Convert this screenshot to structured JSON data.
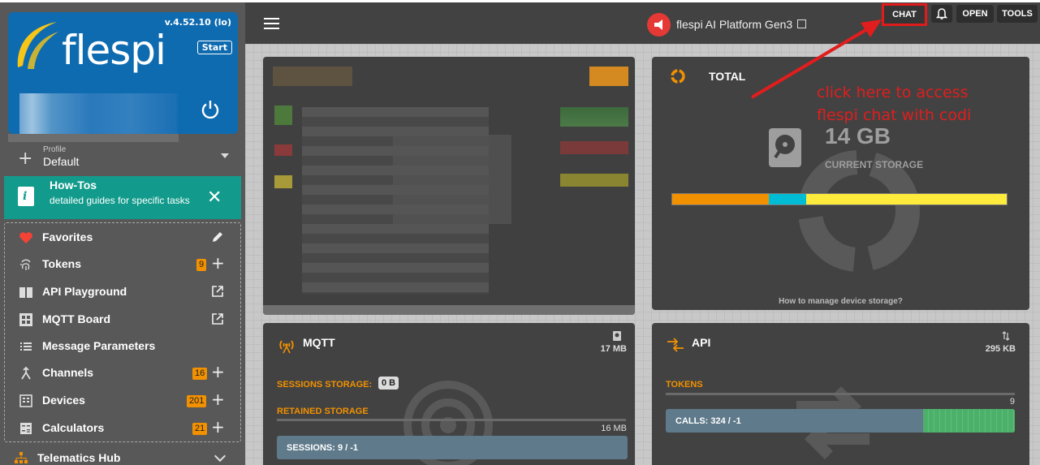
{
  "sidebar": {
    "brand": {
      "logo_text": "flespi",
      "version": "v.4.52.10 (lo)",
      "start_label": "Start"
    },
    "profile": {
      "label": "Profile",
      "value": "Default"
    },
    "howto": {
      "title": "How-Tos",
      "description": "detailed guides for specific tasks"
    },
    "items": [
      {
        "label": "Favorites",
        "icon": "heart-icon"
      },
      {
        "label": "Tokens",
        "icon": "fingerprint-icon",
        "badge": "9"
      },
      {
        "label": "API Playground",
        "icon": "book-icon"
      },
      {
        "label": "MQTT Board",
        "icon": "grid-icon"
      },
      {
        "label": "Message Parameters",
        "icon": "list-icon"
      },
      {
        "label": "Channels",
        "icon": "merge-icon",
        "badge": "16"
      },
      {
        "label": "Devices",
        "icon": "device-icon",
        "badge": "201"
      },
      {
        "label": "Calculators",
        "icon": "calculator-icon",
        "badge": "21"
      }
    ],
    "section": {
      "label": "Telematics Hub"
    }
  },
  "topbar": {
    "platform_title": "flespi AI Platform Gen3",
    "chat_label": "CHAT",
    "open_label": "OPEN",
    "tools_label": "TOOLS"
  },
  "total_card": {
    "title": "TOTAL",
    "storage_value": "14 GB",
    "storage_label": "CURRENT STORAGE",
    "storage_segments": [
      {
        "share": 0.29,
        "color": "#f29100"
      },
      {
        "share": 0.11,
        "color": "#00bcd4"
      },
      {
        "share": 0.6,
        "color": "#ffeb3b"
      }
    ],
    "help_link": "How to manage device storage?"
  },
  "mqtt_card": {
    "title": "MQTT",
    "size": "17 MB",
    "sessions_storage_label": "SESSIONS STORAGE:",
    "sessions_storage_value": "0 B",
    "retained_storage_label": "RETAINED STORAGE",
    "retained_storage_value": "16 MB",
    "sessions_bar": "SESSIONS: 9 / -1"
  },
  "api_card": {
    "title": "API",
    "size": "295 KB",
    "tokens_label": "TOKENS",
    "tokens_value": "9",
    "calls_bar": "CALLS: 324 / -1"
  },
  "annotation": {
    "line1": "click here to access",
    "line2": "flespi chat with codi"
  },
  "colors": {
    "accent": "#f29100",
    "howto_bg": "#129b8c",
    "brand_bg": "#0f6bb0",
    "annotation": "#e21d1d"
  }
}
